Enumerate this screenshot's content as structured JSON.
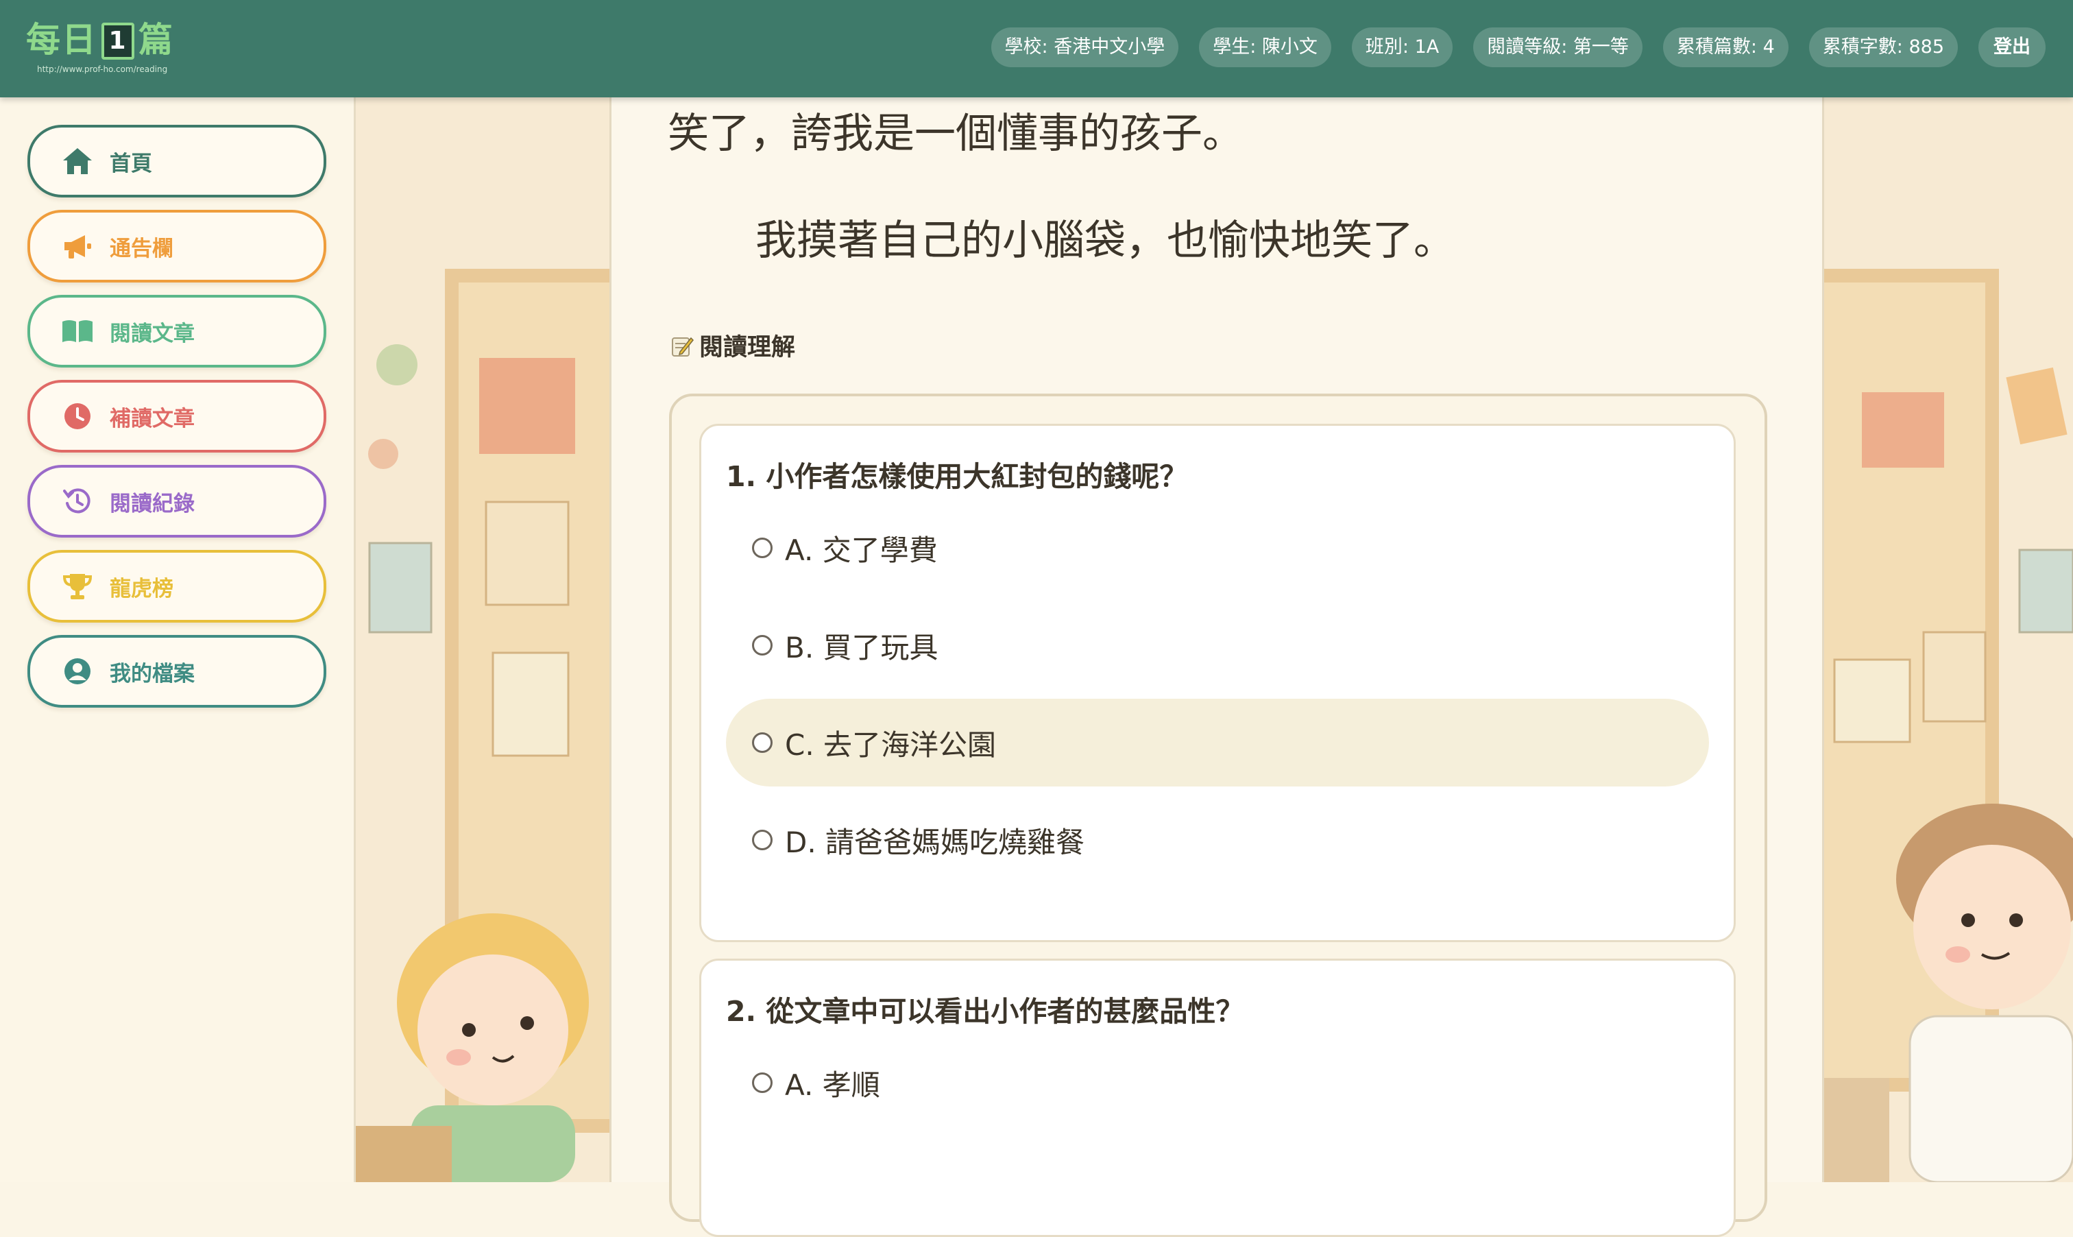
{
  "header": {
    "logo_text_left": "每日",
    "logo_number": "1",
    "logo_text_right": "篇",
    "logo_url": "http://www.prof-ho.com/reading",
    "pills": {
      "school": "學校: 香港中文小學",
      "student": "學生: 陳小文",
      "class": "班別: 1A",
      "level": "閱讀等級: 第一等",
      "articles": "累積篇數: 4",
      "words": "累積字數: 885",
      "logout": "登出"
    }
  },
  "sidebar": {
    "items": [
      {
        "label": "首頁",
        "icon": "home-icon",
        "color": "#3e7a6a"
      },
      {
        "label": "通告欄",
        "icon": "megaphone-icon",
        "color": "#ef9d3c"
      },
      {
        "label": "閱讀文章",
        "icon": "book-icon",
        "color": "#5bb78a"
      },
      {
        "label": "補讀文章",
        "icon": "clock-icon",
        "color": "#e06a66"
      },
      {
        "label": "閱讀紀錄",
        "icon": "history-icon",
        "color": "#9a6ac9"
      },
      {
        "label": "龍虎榜",
        "icon": "trophy-icon",
        "color": "#e8bf3a"
      },
      {
        "label": "我的檔案",
        "icon": "user-circle-icon",
        "color": "#3f8c83"
      }
    ]
  },
  "article": {
    "line1": "笑了，誇我是一個懂事的孩子。",
    "line2": "我摸著自己的小腦袋，也愉快地笑了。"
  },
  "quiz": {
    "section_title": "閱讀理解",
    "questions": [
      {
        "title": "1. 小作者怎樣使用大紅封包的錢呢？",
        "options": [
          {
            "label": "A. 交了學費"
          },
          {
            "label": "B. 買了玩具"
          },
          {
            "label": "C. 去了海洋公園"
          },
          {
            "label": "D. 請爸爸媽媽吃燒雞餐"
          }
        ]
      },
      {
        "title": "2. 從文章中可以看出小作者的甚麼品性？",
        "options": [
          {
            "label": "A. 孝順"
          }
        ]
      }
    ]
  }
}
